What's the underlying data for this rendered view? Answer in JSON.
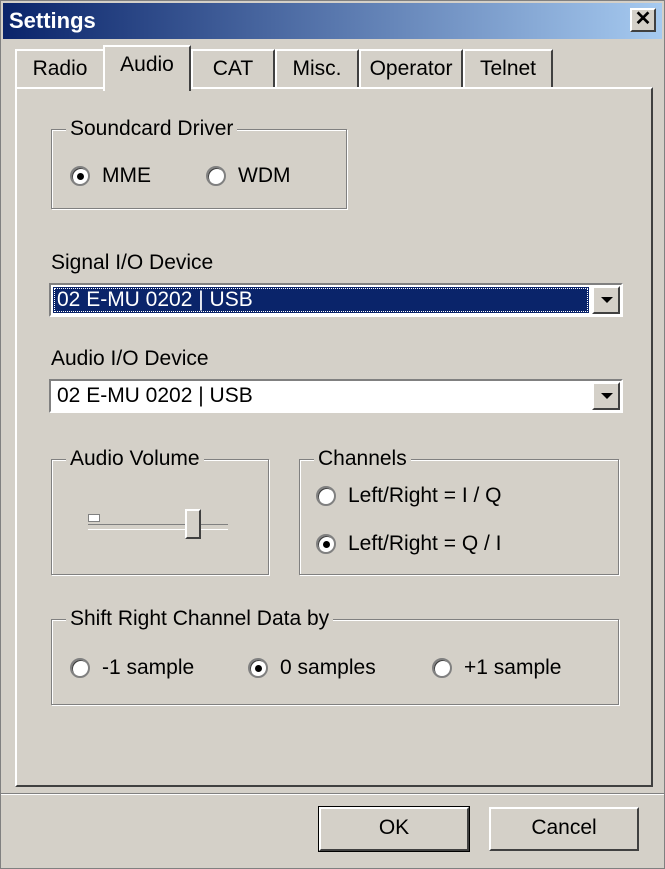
{
  "window": {
    "title": "Settings"
  },
  "tabs": [
    "Radio",
    "Audio",
    "CAT",
    "Misc.",
    "Operator",
    "Telnet"
  ],
  "active_tab": "Audio",
  "soundcard": {
    "label": "Soundcard Driver",
    "options": [
      {
        "label": "MME",
        "checked": true
      },
      {
        "label": "WDM",
        "checked": false
      }
    ]
  },
  "signal_io": {
    "label": "Signal I/O Device",
    "value": "02  E-MU 0202 | USB"
  },
  "audio_io": {
    "label": "Audio I/O Device",
    "value": "02  E-MU 0202 | USB"
  },
  "audio_volume": {
    "label": "Audio Volume",
    "level": 0.75
  },
  "channels": {
    "label": "Channels",
    "options": [
      {
        "label": "Left/Right = I / Q",
        "checked": false
      },
      {
        "label": "Left/Right = Q / I",
        "checked": true
      }
    ]
  },
  "shift": {
    "label": "Shift Right Channel Data by",
    "options": [
      {
        "label": "-1 sample",
        "checked": false
      },
      {
        "label": "0 samples",
        "checked": true
      },
      {
        "label": "+1 sample",
        "checked": false
      }
    ]
  },
  "buttons": {
    "ok": "OK",
    "cancel": "Cancel"
  }
}
